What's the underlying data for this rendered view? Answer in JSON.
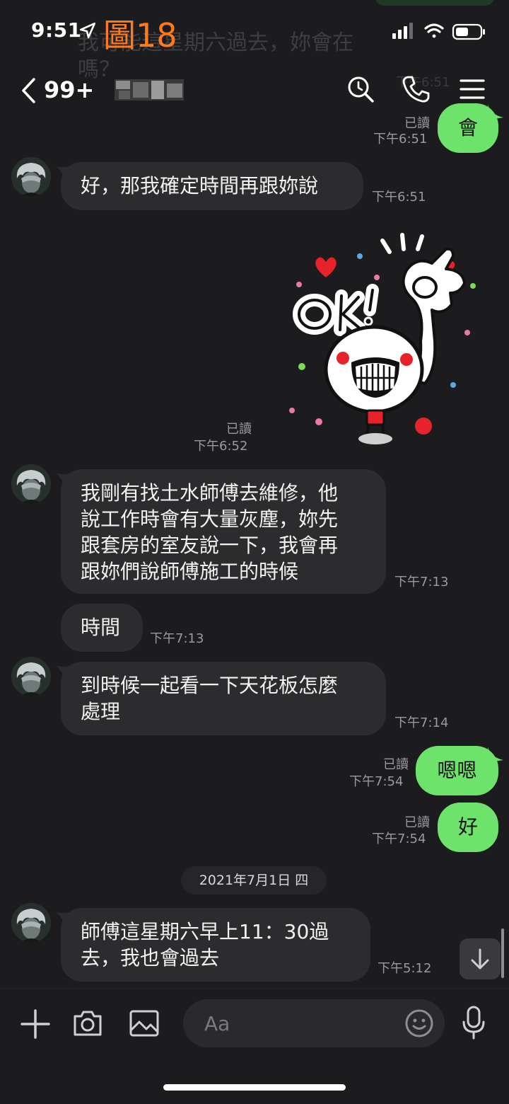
{
  "status_bar": {
    "time": "9:51",
    "figure_label": "圖18"
  },
  "background_preview": {
    "text": "我可能這星期六過去，妳會在嗎？",
    "time": "下午6:51"
  },
  "header": {
    "unread_count": "99+",
    "contact_name": "[blurred]"
  },
  "messages": {
    "m1": {
      "read": "已讀",
      "time": "下午6:51",
      "text": "會"
    },
    "m2": {
      "time": "下午6:51",
      "text": "好，那我確定時間再跟妳說"
    },
    "m3": {
      "read": "已讀",
      "time": "下午6:52",
      "sticker": "OK! sticker"
    },
    "m4": {
      "time": "下午7:13",
      "text": "我剛有找土水師傅去維修，他\n說工作時會有大量灰塵，妳先\n跟套房的室友說一下，我會再\n跟妳們說師傅施工的時候"
    },
    "m5": {
      "time": "下午7:13",
      "text": "時間"
    },
    "m6": {
      "time": "下午7:14",
      "text": "到時候一起看一下天花板怎麼\n處理"
    },
    "m7": {
      "read": "已讀",
      "time": "下午7:54",
      "text": "嗯嗯"
    },
    "m8": {
      "read": "已讀",
      "time": "下午7:54",
      "text": "好"
    },
    "m9": {
      "time": "下午5:12",
      "text": "師傅這星期六早上11：30過\n去，我也會過去"
    }
  },
  "date_separator": "2021年7月1日 四",
  "input": {
    "placeholder": "Aa"
  },
  "colors": {
    "background": "#1c1c1e",
    "incoming_bubble": "#2c2c2e",
    "outgoing_bubble": "#6de36b",
    "figure_label": "#ff7a1a"
  }
}
